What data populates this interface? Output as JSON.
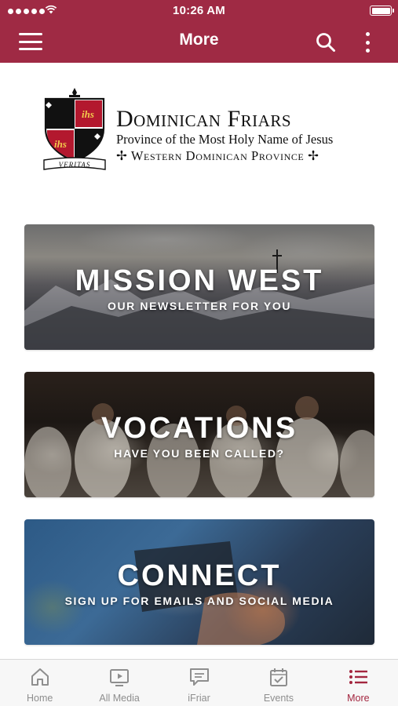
{
  "status_bar": {
    "time": "10:26 AM"
  },
  "nav_bar": {
    "title": "More",
    "menu_icon": "hamburger-menu-icon",
    "search_icon": "search-icon",
    "more_icon": "vertical-ellipsis-icon"
  },
  "logo": {
    "crest_text_top": "ihs",
    "crest_text_bottom": "ihs",
    "motto": "VERITAS",
    "name": "Dominican Friars",
    "line2": "Province of the Most Holy Name of Jesus",
    "line3": "✢ Western Dominican Province ✢"
  },
  "cards": [
    {
      "title": "MISSION WEST",
      "subtitle": "OUR NEWSLETTER FOR YOU"
    },
    {
      "title": "VOCATIONS",
      "subtitle": "HAVE YOU BEEN CALLED?"
    },
    {
      "title": "CONNECT",
      "subtitle": "SIGN UP FOR EMAILS AND SOCIAL MEDIA"
    }
  ],
  "tabs": [
    {
      "label": "Home",
      "icon": "home-icon"
    },
    {
      "label": "All Media",
      "icon": "play-screen-icon"
    },
    {
      "label": "iFriar",
      "icon": "chat-bubble-icon"
    },
    {
      "label": "Events",
      "icon": "calendar-check-icon"
    },
    {
      "label": "More",
      "icon": "list-icon",
      "active": true
    }
  ],
  "colors": {
    "brand": "#9f2a44",
    "active_tab": "#a3263f",
    "inactive_tab": "#8e8e8e"
  }
}
